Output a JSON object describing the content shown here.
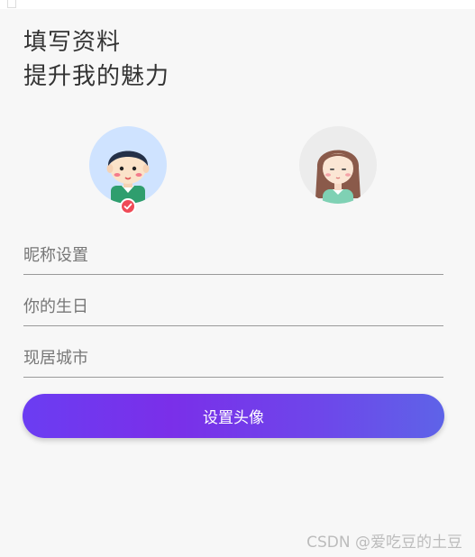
{
  "header": {
    "title_line1": "填写资料",
    "title_line2": "提升我的魅力"
  },
  "avatars": {
    "male": {
      "icon": "male-avatar-icon",
      "selected": true
    },
    "female": {
      "icon": "female-avatar-icon",
      "selected": false
    },
    "selected_badge_icon": "check-icon"
  },
  "form": {
    "nickname": {
      "placeholder": "昵称设置",
      "value": ""
    },
    "birthday": {
      "placeholder": "你的生日",
      "value": ""
    },
    "city": {
      "placeholder": "现居城市",
      "value": ""
    }
  },
  "actions": {
    "submit_label": "设置头像"
  },
  "watermark": "CSDN @爱吃豆的土豆",
  "colors": {
    "accent_start": "#6b3df2",
    "accent_end": "#5e63e8",
    "badge": "#ef4b57",
    "male_bg": "#cfe3ff",
    "female_bg": "#ececec"
  }
}
